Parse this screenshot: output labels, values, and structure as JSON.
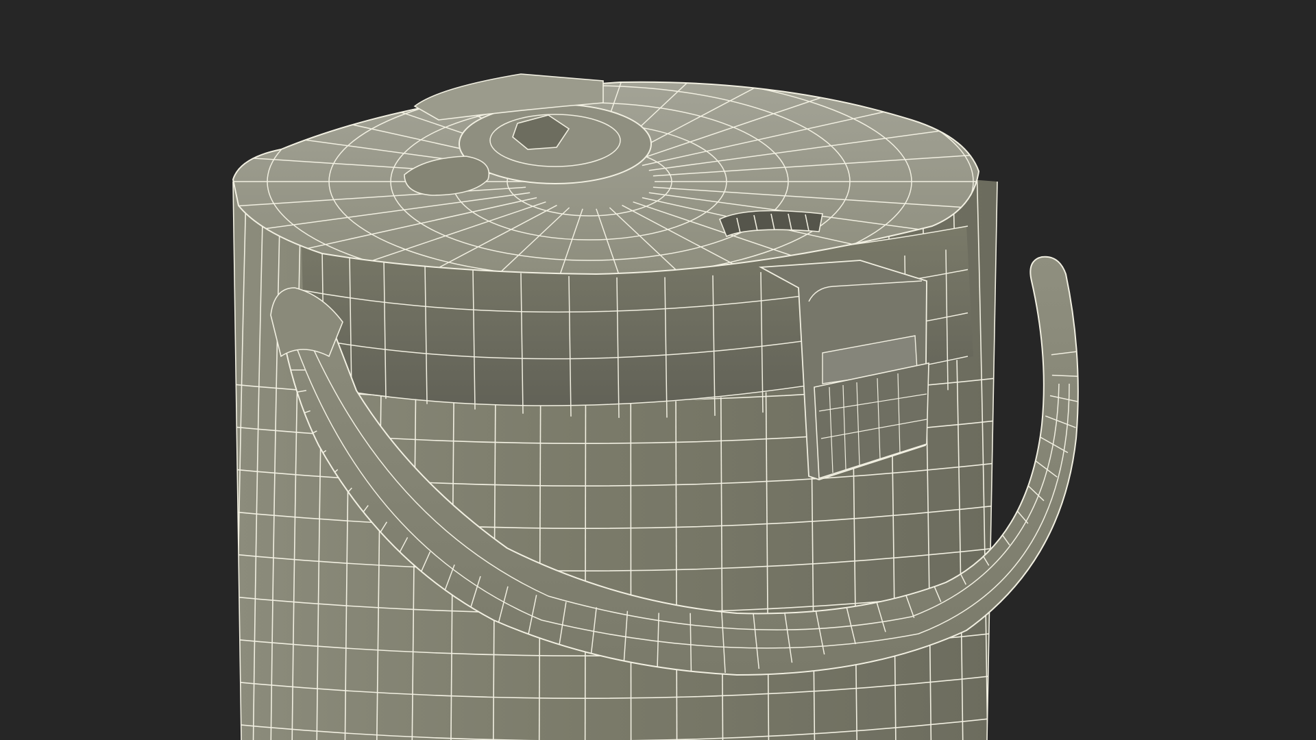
{
  "scene": {
    "subject": "wireframe-cooler-jug",
    "colors": {
      "background": "#262626",
      "shell_light": "#9a9a8c",
      "shell_mid": "#83836f",
      "shell_dark": "#66665a",
      "wire": "#f2f0e2"
    }
  }
}
